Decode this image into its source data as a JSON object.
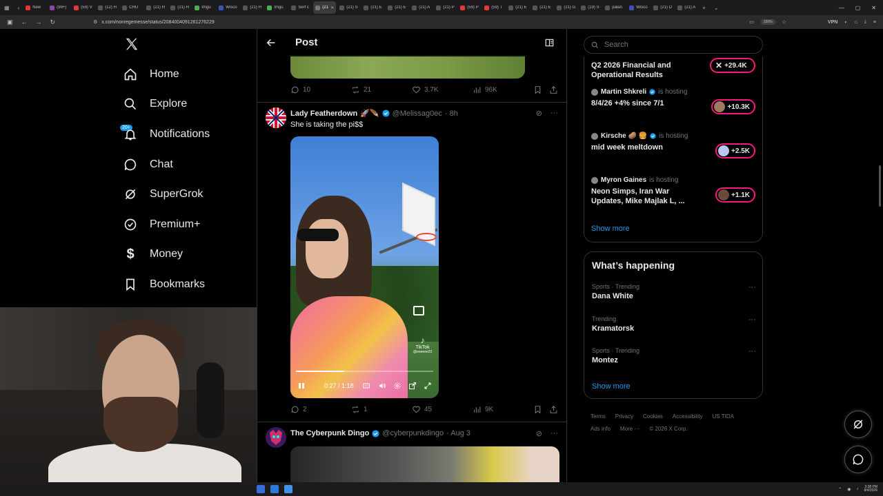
{
  "browser": {
    "tabs": [
      "New",
      "(99+)",
      "(59) V",
      "(12) H",
      "CHU",
      "(21) H",
      "(21) H",
      "Imgu",
      "Wisco",
      "(21) H",
      "Imgu",
      "Serf c",
      "(21)",
      "(21) S",
      "(21) E",
      "(21) E",
      "(21) A",
      "(21) P",
      "(59) P",
      "(59) T",
      "(21) E",
      "(21) E",
      "(21) G",
      "(19) S",
      "palan",
      "Wisco",
      "(21) D",
      "(21) A"
    ],
    "url": "x.com/nonregemesse/status/2084004091261276229",
    "zoom": "150%",
    "vpn": "VPN"
  },
  "nav": {
    "items": [
      {
        "label": "Home",
        "icon": "home-icon"
      },
      {
        "label": "Explore",
        "icon": "search-icon"
      },
      {
        "label": "Notifications",
        "icon": "bell-icon"
      },
      {
        "label": "Chat",
        "icon": "chat-icon"
      },
      {
        "label": "SuperGrok",
        "icon": "grok-icon"
      },
      {
        "label": "Premium+",
        "icon": "premium-icon"
      },
      {
        "label": "Money",
        "icon": "money-icon"
      },
      {
        "label": "Bookmarks",
        "icon": "bookmark-icon"
      }
    ],
    "notifications_badge": "20+"
  },
  "header": {
    "title": "Post"
  },
  "tweet1_actions": {
    "replies": "10",
    "reposts": "21",
    "likes": "3.7K",
    "views": "96K"
  },
  "tweet2": {
    "name": "Lady Featherdown",
    "emoji": "🚀🪶",
    "handle": "@Melissag0ec",
    "time": "· 8h",
    "text": "She is taking the pi$$",
    "video": {
      "time": "0:27 / 1:18",
      "progress": 0.35,
      "watermark": "TikTok",
      "watermark_user": "@eeeeee23"
    },
    "actions": {
      "replies": "2",
      "reposts": "1",
      "likes": "45",
      "views": "9K"
    }
  },
  "tweet3": {
    "name": "The Cyberpunk Dingo",
    "handle": "@cyberpunkdingo",
    "time": "· Aug 3"
  },
  "search": {
    "placeholder": "Search"
  },
  "spaces": [
    {
      "host": "",
      "hosting": "",
      "title": "Q2 2026 Financial and Operational Results",
      "count": "+29.4K"
    },
    {
      "host": "Martin Shkreli",
      "hosting": "is hosting",
      "title": "8/4/26 +4% since 7/1",
      "count": "+10.3K"
    },
    {
      "host": "Kirsche 🥔 🍔",
      "hosting": "is hosting",
      "title": "mid week meltdown",
      "count": "+2.5K"
    },
    {
      "host": "Myron Gaines",
      "hosting": "is hosting",
      "title": "Neon Simps, Iran War Updates, Mike Majlak L, ...",
      "count": "+1.1K"
    }
  ],
  "show_more": "Show more",
  "happening": {
    "title": "What’s happening",
    "trends": [
      {
        "context": "Sports · Trending",
        "name": "Dana White"
      },
      {
        "context": "Trending",
        "name": "Kramatorsk"
      },
      {
        "context": "Sports · Trending",
        "name": "Montez"
      }
    ],
    "show_more": "Show more"
  },
  "footer": {
    "links": [
      "Terms",
      "Privacy",
      "Cookies",
      "Accessibility",
      "US TIDA",
      "Ads info",
      "More ···",
      "© 2026 X Corp."
    ]
  },
  "taskbar": {
    "time": "3:38 PM",
    "date": "8/4/2026"
  },
  "colors": {
    "accent": "#1d9bf0",
    "space_pill": "#f91880",
    "background": "#000000",
    "muted": "#71767b"
  }
}
